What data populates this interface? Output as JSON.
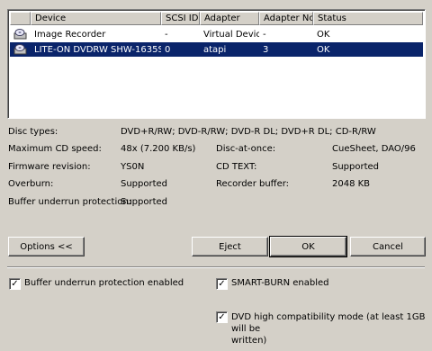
{
  "list": {
    "columns": [
      "",
      "Device",
      "SCSI ID",
      "Adapter",
      "Adapter No.",
      "Status"
    ],
    "rows": [
      {
        "icon": "disc-drive-icon",
        "device": "Image Recorder",
        "scsi_id": "-",
        "adapter": "Virtual Device",
        "adapter_no": "-",
        "status": "OK",
        "selected": false
      },
      {
        "icon": "disc-drive-icon",
        "device": "LITE-ON  DVDRW SHW-1635S",
        "scsi_id": "0",
        "adapter": "atapi",
        "adapter_no": "3",
        "status": "OK",
        "selected": true
      }
    ]
  },
  "info": {
    "disc_types_label": "Disc types:",
    "disc_types_value": "DVD+R/RW; DVD-R/RW; DVD-R DL; DVD+R DL; CD-R/RW",
    "max_speed_label": "Maximum CD speed:",
    "max_speed_value": "48x (7.200 KB/s)",
    "disc_at_once_label": "Disc-at-once:",
    "disc_at_once_value": "CueSheet, DAO/96",
    "firmware_label": "Firmware revision:",
    "firmware_value": "YS0N",
    "cd_text_label": "CD TEXT:",
    "cd_text_value": "Supported",
    "overburn_label": "Overburn:",
    "overburn_value": "Supported",
    "recorder_buffer_label": "Recorder buffer:",
    "recorder_buffer_value": "2048 KB",
    "buffer_underrun_label": "Buffer underrun protection:",
    "buffer_underrun_value": "Supported"
  },
  "buttons": {
    "options": "Options <<",
    "eject": "Eject",
    "ok": "OK",
    "cancel": "Cancel"
  },
  "options": {
    "buffer_underrun_enabled": {
      "label": "Buffer underrun protection enabled",
      "checked": true
    },
    "smart_burn_enabled": {
      "label": "SMART-BURN enabled",
      "checked": true
    },
    "dvd_high_compat_line1": "DVD high compatibility mode (at least 1GB will be",
    "dvd_high_compat_line2": "written)",
    "dvd_high_compat_checked": true
  },
  "colors": {
    "dialog_bg": "#d4d0c8",
    "selection": "#0a246a"
  }
}
